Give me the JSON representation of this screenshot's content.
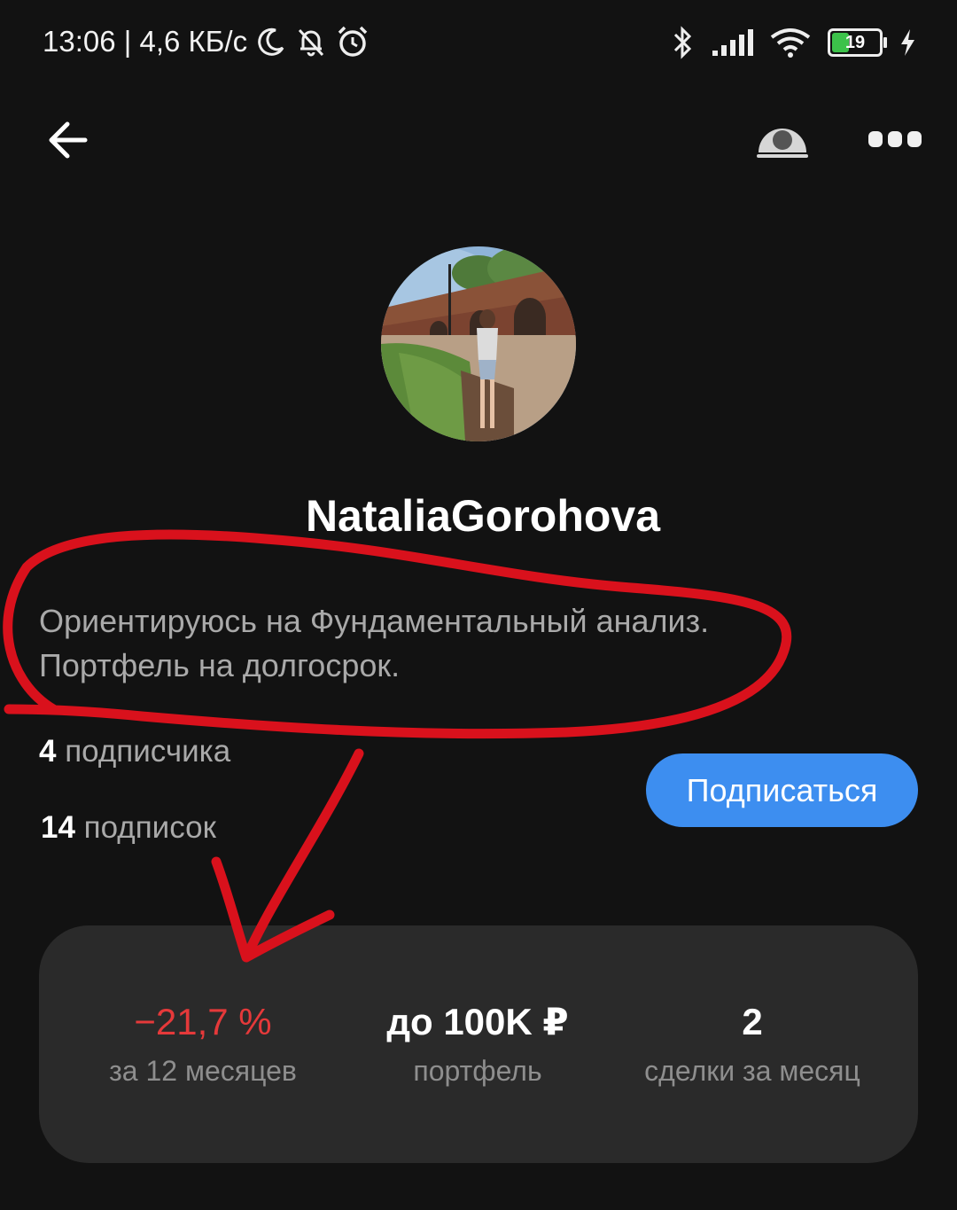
{
  "status_bar": {
    "time_speed": "13:06 | 4,6 КБ/с",
    "battery_level": "19",
    "icons": [
      "moon-icon",
      "bell-off-icon",
      "alarm-icon",
      "bluetooth-icon",
      "signal-icon",
      "wifi-icon",
      "battery-icon",
      "charging-icon"
    ]
  },
  "header": {
    "icons": [
      "back-arrow-icon",
      "profile-action-icon",
      "more-icon"
    ]
  },
  "profile": {
    "username": "NataliaGorohova",
    "bio_line1": "Ориентируюсь на Фундаментальный анализ.",
    "bio_line2": "Портфель на долгосрок.",
    "followers_count": "4",
    "followers_label": " подписчика",
    "following_count": "14",
    "following_label": " подписок",
    "subscribe_label": "Подписаться"
  },
  "stats": [
    {
      "value": "−21,7 %",
      "label": "за 12 месяцев"
    },
    {
      "value": "до 100K ₽",
      "label": "портфель"
    },
    {
      "value": "2",
      "label": "сделки за месяц"
    }
  ],
  "colors": {
    "background": "#121212",
    "accent": "#3d8ef0",
    "negative": "#e5393a",
    "card": "#2a2a2a",
    "annotation": "#d9111c"
  }
}
